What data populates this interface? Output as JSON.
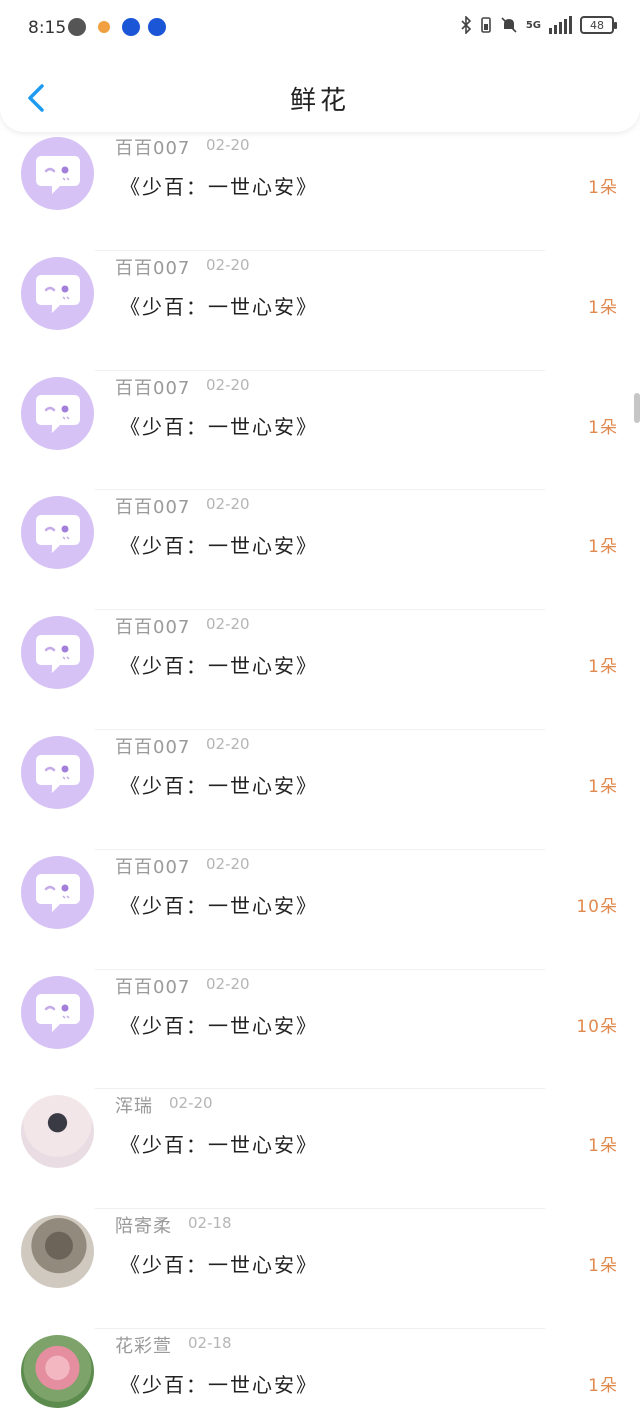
{
  "status_bar": {
    "time": "8:15",
    "network": "5G",
    "battery": "48"
  },
  "header": {
    "title": "鲜花",
    "back_icon": "chevron-left-icon"
  },
  "colors": {
    "accent_blue": "#1e9bf0",
    "count_orange": "#e08a50",
    "default_avatar": "#d7c2f5"
  },
  "gifts": [
    {
      "avatar": "default",
      "name": "百百007",
      "date": "02-20",
      "title": "《少百：一世心安》",
      "count": "1朵"
    },
    {
      "avatar": "default",
      "name": "百百007",
      "date": "02-20",
      "title": "《少百：一世心安》",
      "count": "1朵"
    },
    {
      "avatar": "default",
      "name": "百百007",
      "date": "02-20",
      "title": "《少百：一世心安》",
      "count": "1朵"
    },
    {
      "avatar": "default",
      "name": "百百007",
      "date": "02-20",
      "title": "《少百：一世心安》",
      "count": "1朵"
    },
    {
      "avatar": "default",
      "name": "百百007",
      "date": "02-20",
      "title": "《少百：一世心安》",
      "count": "1朵"
    },
    {
      "avatar": "default",
      "name": "百百007",
      "date": "02-20",
      "title": "《少百：一世心安》",
      "count": "1朵"
    },
    {
      "avatar": "default",
      "name": "百百007",
      "date": "02-20",
      "title": "《少百：一世心安》",
      "count": "10朵"
    },
    {
      "avatar": "default",
      "name": "百百007",
      "date": "02-20",
      "title": "《少百：一世心安》",
      "count": "10朵"
    },
    {
      "avatar": "photo1",
      "name": "浑瑞",
      "date": "02-20",
      "title": "《少百：一世心安》",
      "count": "1朵"
    },
    {
      "avatar": "photo2",
      "name": "陪寄柔",
      "date": "02-18",
      "title": "《少百：一世心安》",
      "count": "1朵"
    },
    {
      "avatar": "photo3",
      "name": "花彩萱",
      "date": "02-18",
      "title": "《少百：一世心安》",
      "count": "1朵"
    }
  ]
}
